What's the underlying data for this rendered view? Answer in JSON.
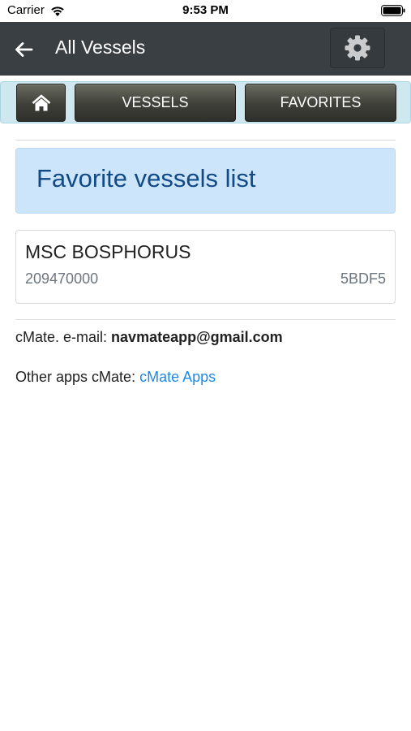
{
  "status_bar": {
    "carrier": "Carrier",
    "time": "9:53 PM",
    "icons": [
      "wifi-icon",
      "battery-icon"
    ]
  },
  "nav": {
    "title": "All Vessels",
    "back_icon": "arrow-left-icon",
    "settings_icon": "gear-icon"
  },
  "buttons": {
    "home_icon": "home-icon",
    "vessels": "VESSELS",
    "favorites": "FAVORITES"
  },
  "heading": "Favorite vessels list",
  "vessels": [
    {
      "name": "MSC BOSPHORUS",
      "mmsi": "209470000",
      "callsign": "5BDF5"
    }
  ],
  "footer": {
    "email_label": "cMate. e-mail:",
    "email": "navmateapp@gmail.com",
    "apps_label": "Other apps cMate:",
    "apps_link": "cMate Apps"
  },
  "colors": {
    "nav_bg": "#3a3f44",
    "button_bar_bg": "#cfe7ee",
    "heading_bg": "#cce5fb",
    "heading_text": "#124a86",
    "link": "#1e88e5"
  }
}
